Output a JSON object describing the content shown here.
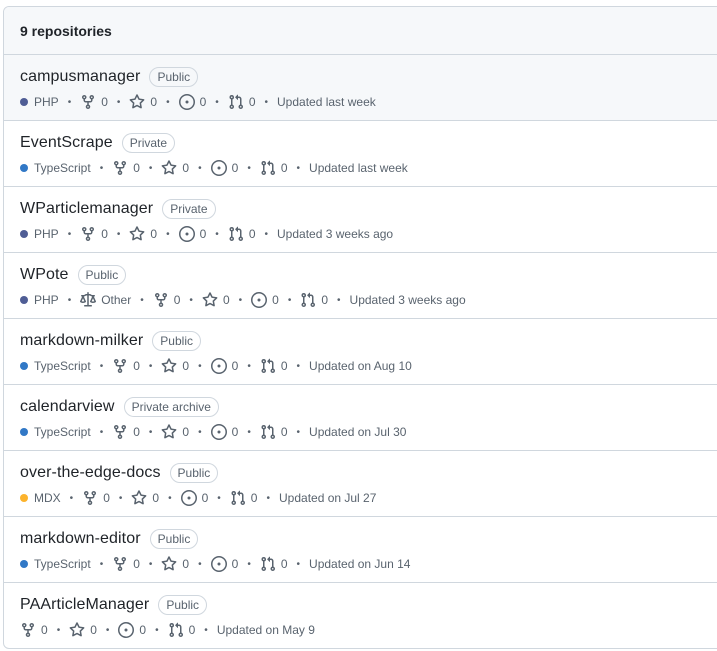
{
  "header": {
    "count_label": "9 repositories"
  },
  "repos": [
    {
      "name": "campusmanager",
      "visibility": "Public",
      "language": "PHP",
      "lang_color": "#4F5D95",
      "license": null,
      "forks": "0",
      "stars": "0",
      "issues": "0",
      "pulls": "0",
      "updated": "Updated last week"
    },
    {
      "name": "EventScrape",
      "visibility": "Private",
      "language": "TypeScript",
      "lang_color": "#3178c6",
      "license": null,
      "forks": "0",
      "stars": "0",
      "issues": "0",
      "pulls": "0",
      "updated": "Updated last week"
    },
    {
      "name": "WParticlemanager",
      "visibility": "Private",
      "language": "PHP",
      "lang_color": "#4F5D95",
      "license": null,
      "forks": "0",
      "stars": "0",
      "issues": "0",
      "pulls": "0",
      "updated": "Updated 3 weeks ago"
    },
    {
      "name": "WPote",
      "visibility": "Public",
      "language": "PHP",
      "lang_color": "#4F5D95",
      "license": "Other",
      "forks": "0",
      "stars": "0",
      "issues": "0",
      "pulls": "0",
      "updated": "Updated 3 weeks ago"
    },
    {
      "name": "markdown-milker",
      "visibility": "Public",
      "language": "TypeScript",
      "lang_color": "#3178c6",
      "license": null,
      "forks": "0",
      "stars": "0",
      "issues": "0",
      "pulls": "0",
      "updated": "Updated on Aug 10"
    },
    {
      "name": "calendarview",
      "visibility": "Private archive",
      "language": "TypeScript",
      "lang_color": "#3178c6",
      "license": null,
      "forks": "0",
      "stars": "0",
      "issues": "0",
      "pulls": "0",
      "updated": "Updated on Jul 30"
    },
    {
      "name": "over-the-edge-docs",
      "visibility": "Public",
      "language": "MDX",
      "lang_color": "#fcb32c",
      "license": null,
      "forks": "0",
      "stars": "0",
      "issues": "0",
      "pulls": "0",
      "updated": "Updated on Jul 27"
    },
    {
      "name": "markdown-editor",
      "visibility": "Public",
      "language": "TypeScript",
      "lang_color": "#3178c6",
      "license": null,
      "forks": "0",
      "stars": "0",
      "issues": "0",
      "pulls": "0",
      "updated": "Updated on Jun 14"
    },
    {
      "name": "PAArticleManager",
      "visibility": "Public",
      "language": null,
      "lang_color": null,
      "license": null,
      "forks": "0",
      "stars": "0",
      "issues": "0",
      "pulls": "0",
      "updated": "Updated on May 9"
    }
  ],
  "icons": {
    "fork": "fork-icon",
    "star": "star-icon",
    "issue": "issue-icon",
    "pull": "pull-request-icon",
    "license": "law-icon"
  },
  "colors": {
    "border": "#d0d7de",
    "muted": "#59636e",
    "header_bg": "#f6f8fa"
  }
}
